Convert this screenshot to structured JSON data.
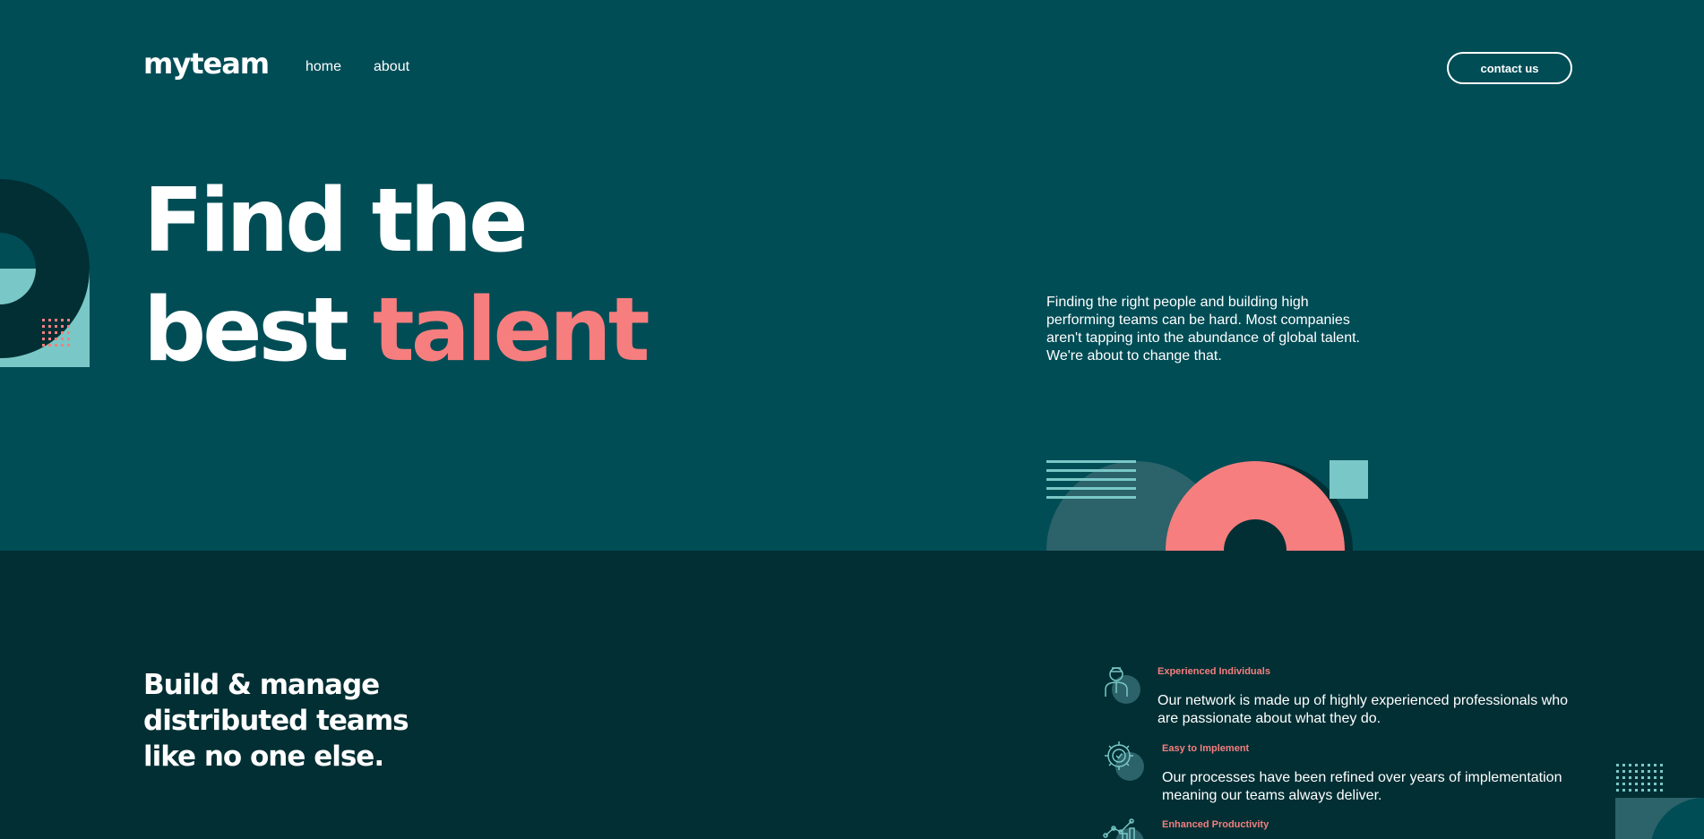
{
  "header": {
    "logo": "myteam",
    "nav": [
      {
        "label": "home"
      },
      {
        "label": "about"
      }
    ],
    "contact_label": "contact us"
  },
  "hero": {
    "line1": "Find the",
    "line2_prefix": "best",
    "line2_accent": "talent",
    "description": "Finding the right people and building high performing teams can be hard. Most companies aren't tapping into the abundance of global talent. We're about to change that."
  },
  "section": {
    "title": "Build & manage distributed teams like no one else.",
    "features": [
      {
        "icon": "person-icon",
        "title": "Experienced Individuals",
        "text": "Our network is made up of highly experienced professionals who are passionate about what they do."
      },
      {
        "icon": "cog-check-icon",
        "title": "Easy to Implement",
        "text": "Our processes have been refined over years of implementation meaning our teams always deliver."
      },
      {
        "icon": "chart-icon",
        "title": "Enhanced Productivity",
        "text": ""
      }
    ]
  },
  "colors": {
    "hero_bg": "#004d56",
    "section_bg": "#012f34",
    "accent": "#f67e7e",
    "teal_light": "#79c8c7",
    "teal_mid": "#2c6269"
  }
}
